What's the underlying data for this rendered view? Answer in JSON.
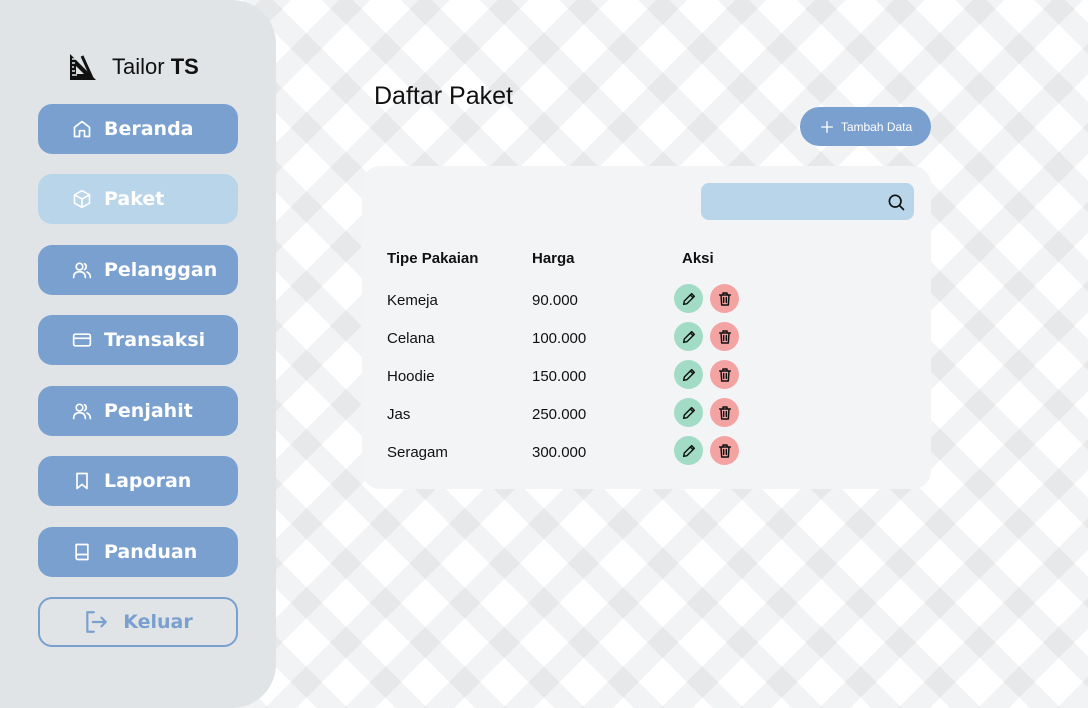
{
  "brand": {
    "name_regular": "Tailor ",
    "name_bold": "TS"
  },
  "sidebar": {
    "items": [
      {
        "label": "Beranda",
        "icon": "home-icon",
        "active": false
      },
      {
        "label": "Paket",
        "icon": "box-icon",
        "active": true
      },
      {
        "label": "Pelanggan",
        "icon": "users-icon",
        "active": false
      },
      {
        "label": "Transaksi",
        "icon": "card-icon",
        "active": false
      },
      {
        "label": "Penjahit",
        "icon": "users-icon",
        "active": false
      },
      {
        "label": "Laporan",
        "icon": "bookmark-icon",
        "active": false
      },
      {
        "label": "Panduan",
        "icon": "book-icon",
        "active": false
      }
    ],
    "logout_label": "Keluar"
  },
  "main": {
    "title": "Daftar Paket",
    "add_button_label": "Tambah Data",
    "search": {
      "value": "",
      "placeholder": ""
    },
    "table": {
      "headers": [
        "Tipe Pakaian",
        "Harga",
        "Aksi"
      ],
      "rows": [
        {
          "tipe": "Kemeja",
          "harga": "90.000"
        },
        {
          "tipe": "Celana",
          "harga": "100.000"
        },
        {
          "tipe": "Hoodie",
          "harga": "150.000"
        },
        {
          "tipe": "Jas",
          "harga": "250.000"
        },
        {
          "tipe": "Seragam",
          "harga": "300.000"
        }
      ]
    }
  },
  "colors": {
    "sidebar_bg": "#e0e4e6",
    "nav_default": "#7aa0cf",
    "nav_active": "#b8d5ea",
    "edit": "#a3dcc6",
    "delete": "#f4a3a3"
  }
}
